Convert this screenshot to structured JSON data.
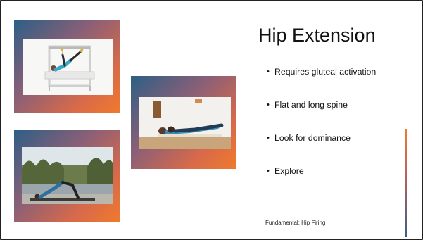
{
  "slide": {
    "title": "Hip Extension",
    "bullets": [
      "Requires gluteal activation",
      "Flat and long spine",
      "Look for dominance",
      "Explore"
    ],
    "footer": "Fundamental: Hip Firing"
  },
  "colors": {
    "gradient_blue": "#2c5f86",
    "gradient_orange": "#f07a2c"
  }
}
